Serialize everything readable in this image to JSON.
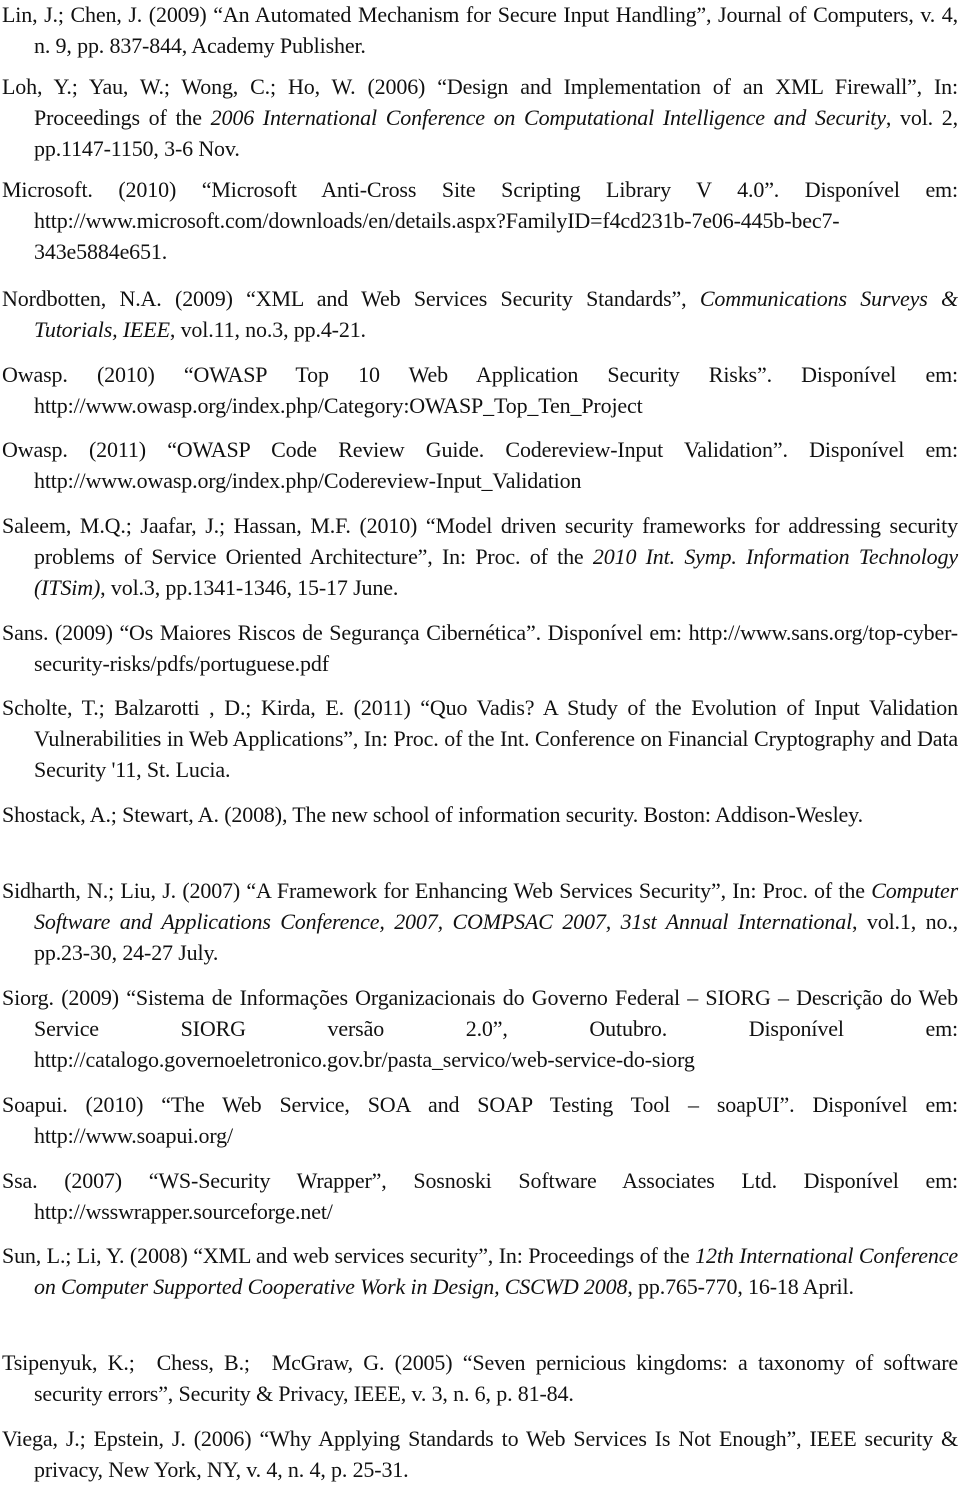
{
  "document": {
    "section": "references",
    "references": [
      {
        "id": "lin-2009",
        "segments": [
          {
            "text": "Lin, J.; Chen, J. (2009) “An Automated Mechanism for Secure Input Handling”, Journal of Computers, v. 4, n. 9, pp. 837-844, Academy Publisher.",
            "italic": false
          }
        ]
      },
      {
        "id": "loh-2006",
        "segments": [
          {
            "text": "Loh, Y.; Yau, W.; Wong, C.; Ho, W. (2006) “Design and Implementation of an XML Firewall”, In: Proceedings of the ",
            "italic": false
          },
          {
            "text": "2006 International Conference on Computational Intelligence and Security",
            "italic": true
          },
          {
            "text": ", vol. 2, pp.1147-1150, 3-6 Nov.",
            "italic": false
          }
        ]
      },
      {
        "id": "microsoft-2010",
        "segments": [
          {
            "text": "Microsoft. (2010) “Microsoft Anti-Cross Site Scripting Library V 4.0”. Disponível em: http://www.microsoft.com/downloads/en/details.aspx?FamilyID=f4cd231b-7e06-445b-bec7-343e5884e651.",
            "italic": false
          }
        ]
      },
      {
        "id": "nordbotten-2009",
        "segments": [
          {
            "text": "Nordbotten, N.A. (2009) “XML and Web Services Security Standards”, ",
            "italic": false
          },
          {
            "text": "Communications Surveys & Tutorials, IEEE",
            "italic": true
          },
          {
            "text": ", vol.11, no.3, pp.4-21.",
            "italic": false
          }
        ]
      },
      {
        "id": "owasp-2010",
        "segments": [
          {
            "text": "Owasp. (2010) “OWASP Top 10 Web Application Security Risks”. Disponível em: http://www.owasp.org/index.php/Category:OWASP_Top_Ten_Project",
            "italic": false
          }
        ]
      },
      {
        "id": "owasp-2011",
        "segments": [
          {
            "text": "Owasp. (2011) “OWASP Code Review Guide. Codereview-Input Validation”. Disponível em: http://www.owasp.org/index.php/Codereview-Input_Validation",
            "italic": false
          }
        ]
      },
      {
        "id": "saleem-2010",
        "segments": [
          {
            "text": "Saleem, M.Q.; Jaafar, J.; Hassan, M.F. (2010) “Model driven security frameworks for addressing security problems of Service Oriented Architecture”, In: Proc. of the ",
            "italic": false
          },
          {
            "text": "2010 Int. Symp. Information Technology (ITSim)",
            "italic": true
          },
          {
            "text": ", vol.3, pp.1341-1346, 15-17 June.",
            "italic": false
          }
        ]
      },
      {
        "id": "sans-2009",
        "segments": [
          {
            "text": "Sans. (2009) “Os Maiores Riscos de Segurança Cibernética”. Disponível em: http://www.sans.org/top-cyber-security-risks/pdfs/portuguese.pdf",
            "italic": false
          }
        ]
      },
      {
        "id": "scholte-2011",
        "segments": [
          {
            "text": "Scholte, T.; Balzarotti , D.; Kirda, E. (2011) “Quo Vadis? A Study of the Evolution of Input Validation Vulnerabilities in Web Applications”, In: Proc. of the Int. Conference on Financial Cryptography and Data Security '11, St. Lucia.",
            "italic": false
          }
        ]
      },
      {
        "id": "shostack-2008",
        "segments": [
          {
            "text": "Shostack, A.; Stewart, A. (2008), The new school of information security. Boston: Addison-Wesley.",
            "italic": false
          }
        ]
      },
      {
        "id": "sidharth-2007",
        "segments": [
          {
            "text": "Sidharth, N.; Liu, J. (2007) “A Framework for Enhancing Web Services Security”, In: Proc. of the ",
            "italic": false
          },
          {
            "text": "Computer Software and Applications Conference, 2007, COMPSAC 2007, 31st Annual International",
            "italic": true
          },
          {
            "text": ", vol.1, no., pp.23-30, 24-27 July.",
            "italic": false
          }
        ]
      },
      {
        "id": "siorg-2009",
        "segments": [
          {
            "text": "Siorg. (2009) “Sistema de Informações Organizacionais do Governo Federal – SIORG – Descrição do Web Service SIORG versão 2.0”, Outubro. Disponível em: http://catalogo.governoeletronico.gov.br/pasta_servico/web-service-do-siorg",
            "italic": false
          }
        ]
      },
      {
        "id": "soapui-2010",
        "segments": [
          {
            "text": "Soapui. (2010) “The Web Service, SOA and SOAP Testing Tool – soapUI”. Disponível em: http://www.soapui.org/",
            "italic": false
          }
        ]
      },
      {
        "id": "ssa-2007",
        "segments": [
          {
            "text": "Ssa. (2007) “WS-Security Wrapper”, Sosnoski Software Associates Ltd. Disponível em: http://wsswrapper.sourceforge.net/",
            "italic": false
          }
        ]
      },
      {
        "id": "sun-2008",
        "segments": [
          {
            "text": "Sun, L.; Li, Y. (2008) “XML and web services security”, In: Proceedings of the ",
            "italic": false
          },
          {
            "text": "12th International Conference on Computer Supported Cooperative Work in Design, CSCWD 2008",
            "italic": true
          },
          {
            "text": ", pp.765-770, 16-18 April.",
            "italic": false
          }
        ]
      },
      {
        "id": "tsipenyuk-2005",
        "segments": [
          {
            "text": "Tsipenyuk, K.; Chess, B.; McGraw, G. (2005) “Seven pernicious kingdoms: a taxonomy of software security errors”, Security & Privacy, IEEE, v. 3, n. 6, p. 81-84.",
            "italic": false
          }
        ]
      },
      {
        "id": "viega-2006",
        "segments": [
          {
            "text": "Viega, J.; Epstein, J. (2006) “Why Applying Standards to Web Services Is Not Enough”, IEEE security & privacy, New York, NY, v. 4, n. 4, p. 25-31.",
            "italic": false
          }
        ]
      }
    ]
  }
}
